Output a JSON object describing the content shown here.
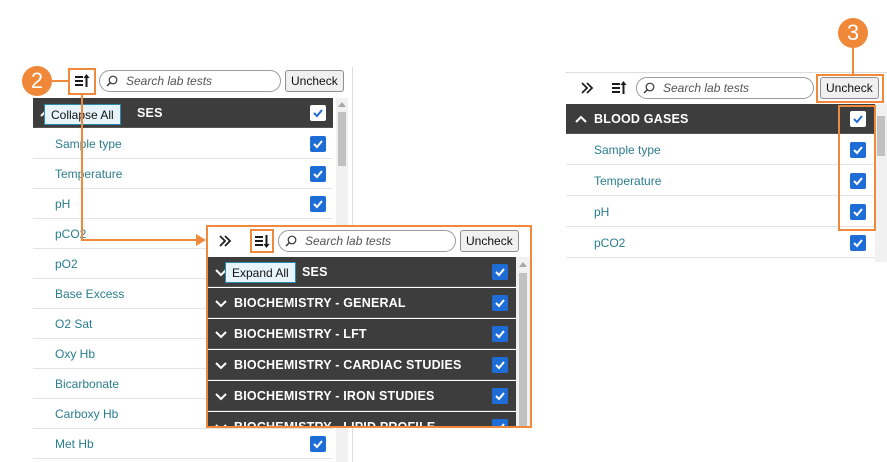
{
  "colors": {
    "accent": "#ef8a3c",
    "checkbox": "#1e6cd6",
    "header_bg": "#3d3d3d",
    "link_text": "#2a7d8e",
    "tooltip_bg": "#e8f4fb"
  },
  "callouts": {
    "step2": "2",
    "step3": "3"
  },
  "left_panel": {
    "search_placeholder": "Search lab tests",
    "uncheck_label": "Uncheck",
    "tooltip": "Collapse All",
    "group_header_visible": "SES",
    "items": [
      {
        "label": "Sample type",
        "checked": true
      },
      {
        "label": "Temperature",
        "checked": true
      },
      {
        "label": "pH",
        "checked": true
      },
      {
        "label": "pCO2",
        "checked": true
      },
      {
        "label": "pO2",
        "checked": true
      },
      {
        "label": "Base Excess",
        "checked": true
      },
      {
        "label": "O2 Sat",
        "checked": true
      },
      {
        "label": "Oxy Hb",
        "checked": true
      },
      {
        "label": "Bicarbonate",
        "checked": true
      },
      {
        "label": "Carboxy Hb",
        "checked": true
      },
      {
        "label": "Met Hb",
        "checked": true
      }
    ]
  },
  "middle_panel": {
    "search_placeholder": "Search lab tests",
    "uncheck_label": "Uncheck",
    "tooltip": "Expand All",
    "first_header_visible": "SES",
    "groups": [
      "BIOCHEMISTRY - GENERAL",
      "BIOCHEMISTRY - LFT",
      "BIOCHEMISTRY - CARDIAC STUDIES",
      "BIOCHEMISTRY - IRON STUDIES",
      "BIOCHEMISTRY - LIPID PROFILE"
    ]
  },
  "right_panel": {
    "search_placeholder": "Search lab tests",
    "uncheck_label": "Uncheck",
    "group_header": "BLOOD GASES",
    "items": [
      {
        "label": "Sample type",
        "checked": true
      },
      {
        "label": "Temperature",
        "checked": true
      },
      {
        "label": "pH",
        "checked": true
      },
      {
        "label": "pCO2",
        "checked": true
      }
    ]
  }
}
